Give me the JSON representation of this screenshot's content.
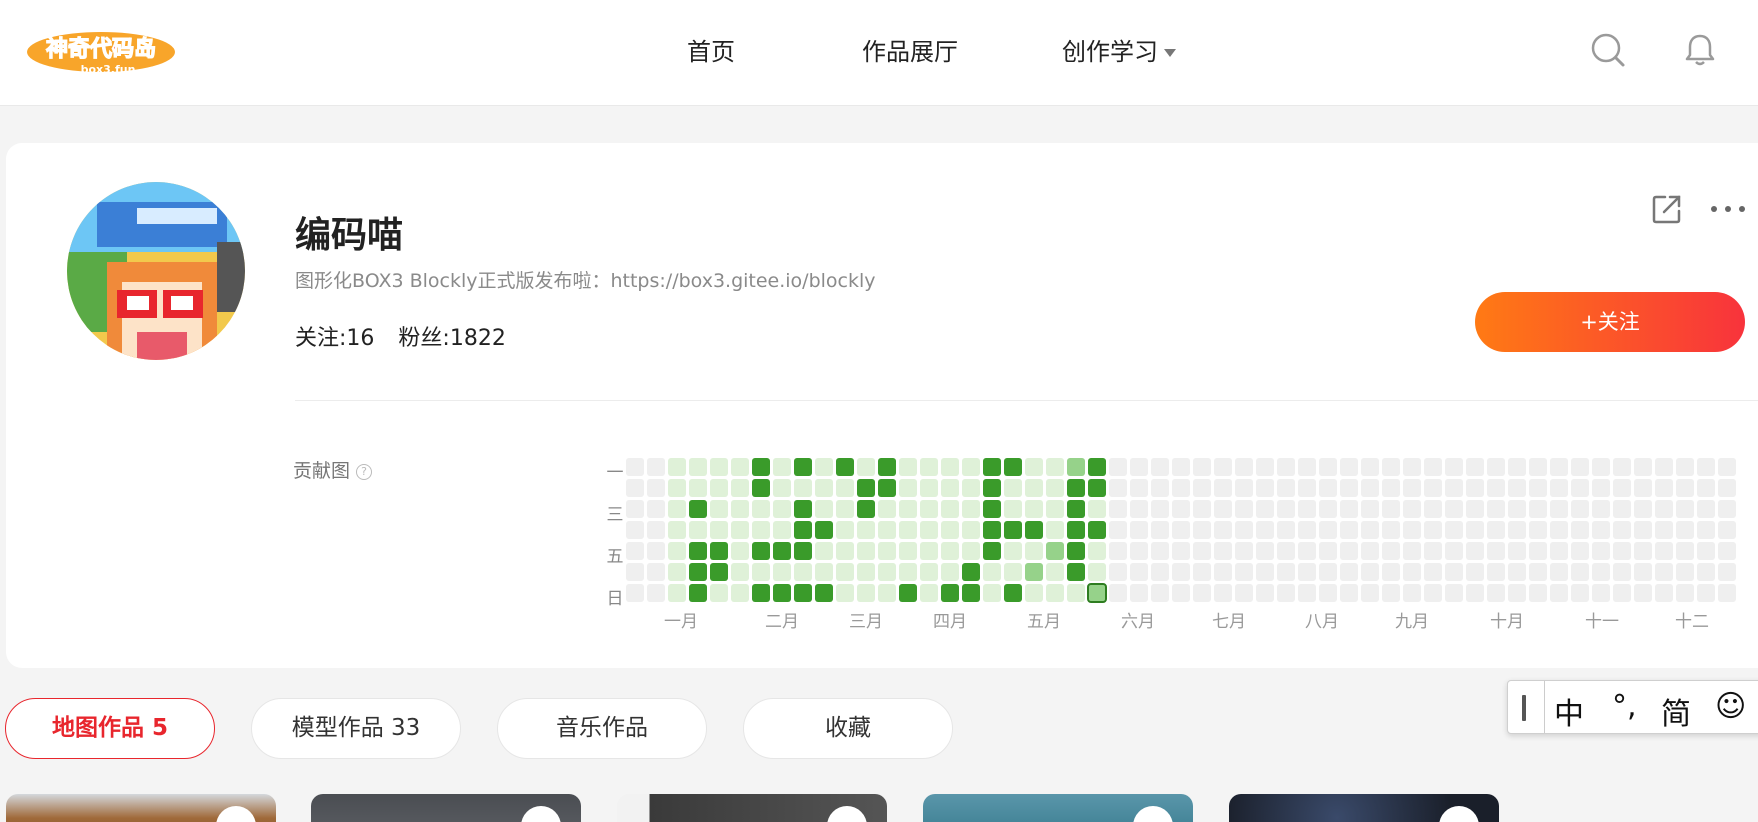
{
  "nav": {
    "logo_text": "神奇代码岛",
    "logo_sub": "box3.fun",
    "items": [
      {
        "label": "首页"
      },
      {
        "label": "作品展厅"
      },
      {
        "label": "创作学习"
      }
    ],
    "search_icon": "search-icon",
    "bell_icon": "bell-icon"
  },
  "profile": {
    "name": "编码喵",
    "bio": "图形化BOX3 Blockly正式版发布啦：https://box3.gitee.io/blockly",
    "following": "关注:16",
    "followers": "粉丝:1822",
    "follow_label": "+关注",
    "share_icon": "share-icon",
    "more_icon": "more-icon"
  },
  "contribution": {
    "label": "贡献图",
    "help": "?",
    "weekday_labels": [
      "一",
      "三",
      "五",
      "日"
    ],
    "months": [
      "一月",
      "二月",
      "三月",
      "四月",
      "五月",
      "六月",
      "七月",
      "八月",
      "九月",
      "十月",
      "十一",
      "十二"
    ],
    "levels": {
      "1": [
        "3-1",
        "3-2",
        "3-3",
        "3-4",
        "4-1",
        "4-2",
        "4-3",
        "4-4",
        "4-6",
        "5-0",
        "5-1",
        "5-2",
        "5-3",
        "5-4",
        "5-5",
        "5-6",
        "6-0",
        "6-1",
        "6-3",
        "6-6",
        "7-1",
        "7-2",
        "7-3",
        "7-4",
        "7-5",
        "8-0",
        "8-1",
        "8-2",
        "8-3",
        "8-4",
        "8-5",
        "9-2",
        "9-3",
        "9-4",
        "9-5",
        "9-6",
        "10-0",
        "10-1",
        "10-2",
        "10-3",
        "10-4",
        "10-5",
        "10-6",
        "11-2",
        "11-3",
        "11-4",
        "11-5",
        "11-6",
        "12-0",
        "12-1",
        "12-2",
        "12-3",
        "12-4",
        "12-5",
        "13-0",
        "13-1",
        "13-2",
        "13-3",
        "13-4",
        "13-5",
        "13-6",
        "14-0",
        "14-1",
        "14-2",
        "14-3",
        "14-4",
        "14-5",
        "14-6",
        "15-0",
        "15-1",
        "15-2",
        "15-3",
        "15-4",
        "15-5",
        "15-6",
        "16-0",
        "16-1",
        "16-2",
        "16-3",
        "16-5",
        "16-6",
        "17-2",
        "17-3",
        "17-5",
        "17-6",
        "18-1",
        "18-2",
        "18-4",
        "18-5",
        "18-6",
        "19-4",
        "19-5",
        "20-0",
        "20-1",
        "20-3",
        "20-4",
        "20-5",
        "20-6",
        "21-1",
        "21-2",
        "21-4",
        "21-5",
        "21-6",
        "22-2",
        "22-4",
        "22-5",
        "22-6"
      ],
      "2": [
        "20-4",
        "19-5",
        "21-0"
      ],
      "3": [
        "3-2",
        "3-4",
        "3-5",
        "3-6",
        "4-4",
        "4-5",
        "6-0",
        "6-1",
        "6-4",
        "6-6",
        "7-4",
        "7-6",
        "8-0",
        "8-2",
        "8-3",
        "8-4",
        "8-6",
        "9-3",
        "9-6",
        "10-0",
        "11-1",
        "11-2",
        "12-0",
        "12-1",
        "13-6",
        "15-6",
        "16-5",
        "16-6",
        "17-0",
        "17-1",
        "17-2",
        "17-3",
        "17-4",
        "18-0",
        "18-3",
        "18-6",
        "19-3",
        "21-0",
        "21-1",
        "21-2",
        "21-3",
        "21-4",
        "21-5",
        "22-0",
        "22-1",
        "22-3"
      ],
      "hl": [
        "22-6"
      ]
    }
  },
  "tabs": [
    {
      "label": "地图作品 5"
    },
    {
      "label": "模型作品 33"
    },
    {
      "label": "音乐作品"
    },
    {
      "label": "收藏"
    }
  ],
  "ime": {
    "lang": "中",
    "punct": "°,",
    "mode": "简",
    "emoji": "☺"
  }
}
